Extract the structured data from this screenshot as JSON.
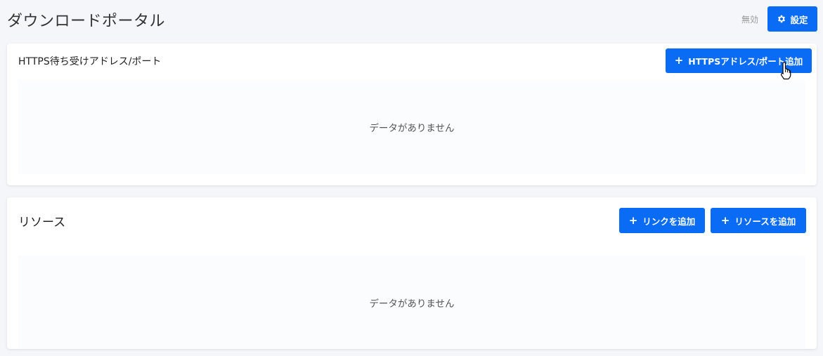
{
  "header": {
    "title": "ダウンロードポータル",
    "status": "無効",
    "settings_label": "設定"
  },
  "https_section": {
    "title": "HTTPS待ち受けアドレス/ポート",
    "add_button_label": "HTTPSアドレス/ポート追加",
    "empty_text": "データがありません"
  },
  "resources_section": {
    "title": "リソース",
    "add_link_label": "リンクを追加",
    "add_resource_label": "リソースを追加",
    "empty_text": "データがありません"
  },
  "colors": {
    "accent": "#0a6cf5",
    "background": "#f4f6fa"
  }
}
